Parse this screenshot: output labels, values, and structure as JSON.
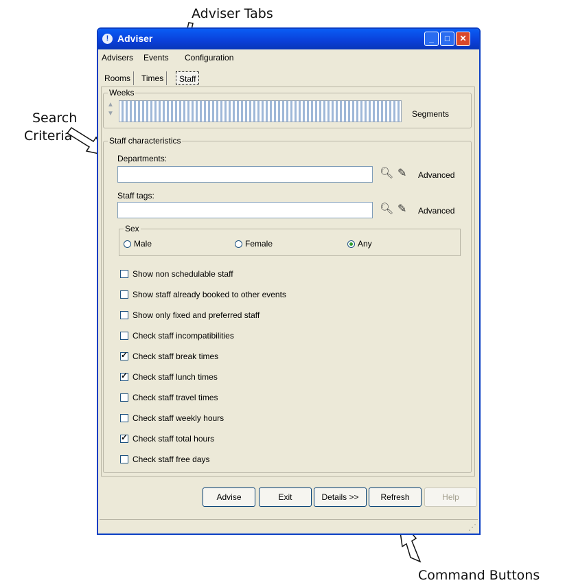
{
  "annotations": {
    "adviser_tabs": "Adviser Tabs",
    "search_criteria_line1": "Search",
    "search_criteria_line2": "Criteria",
    "command_buttons": "Command Buttons"
  },
  "window": {
    "title": "Adviser",
    "app_icon": "!",
    "controls": {
      "minimize": "_",
      "maximize": "□",
      "close": "✕"
    }
  },
  "menu": [
    "Advisers",
    "Events",
    "Configuration"
  ],
  "tabs": [
    {
      "label": "Rooms",
      "active": false
    },
    {
      "label": "Times",
      "active": false
    },
    {
      "label": "Staff",
      "active": true
    }
  ],
  "weeks": {
    "label": "Weeks",
    "segments_label": "Segments"
  },
  "staff_characteristics": {
    "label": "Staff characteristics",
    "departments": {
      "label": "Departments:",
      "value": "",
      "advanced": "Advanced"
    },
    "staff_tags": {
      "label": "Staff tags:",
      "value": "",
      "advanced": "Advanced"
    },
    "sex": {
      "label": "Sex",
      "options": [
        {
          "label": "Male",
          "selected": false
        },
        {
          "label": "Female",
          "selected": false
        },
        {
          "label": "Any",
          "selected": true
        }
      ]
    },
    "checkboxes": [
      {
        "label": "Show non schedulable staff",
        "checked": false
      },
      {
        "label": "Show staff already booked to other events",
        "checked": false
      },
      {
        "label": "Show only fixed and preferred staff",
        "checked": false
      },
      {
        "label": "Check staff incompatibilities",
        "checked": false
      },
      {
        "label": "Check staff break times",
        "checked": true
      },
      {
        "label": "Check staff lunch times",
        "checked": true
      },
      {
        "label": "Check staff travel times",
        "checked": false
      },
      {
        "label": "Check staff weekly hours",
        "checked": false
      },
      {
        "label": "Check staff total hours",
        "checked": true
      },
      {
        "label": "Check staff free days",
        "checked": false
      }
    ]
  },
  "buttons": [
    {
      "label": "Advise",
      "enabled": true
    },
    {
      "label": "Exit",
      "enabled": true
    },
    {
      "label": "Details >>",
      "enabled": true
    },
    {
      "label": "Refresh",
      "enabled": true
    },
    {
      "label": "Help",
      "enabled": false
    }
  ],
  "icons": {
    "search": "search-icon",
    "edit": "pencil-icon",
    "resize": "resize-grip-icon"
  },
  "colors": {
    "titlebar": "#0a4fe0",
    "window_bg": "#ece9d8",
    "close": "#d9472b"
  }
}
